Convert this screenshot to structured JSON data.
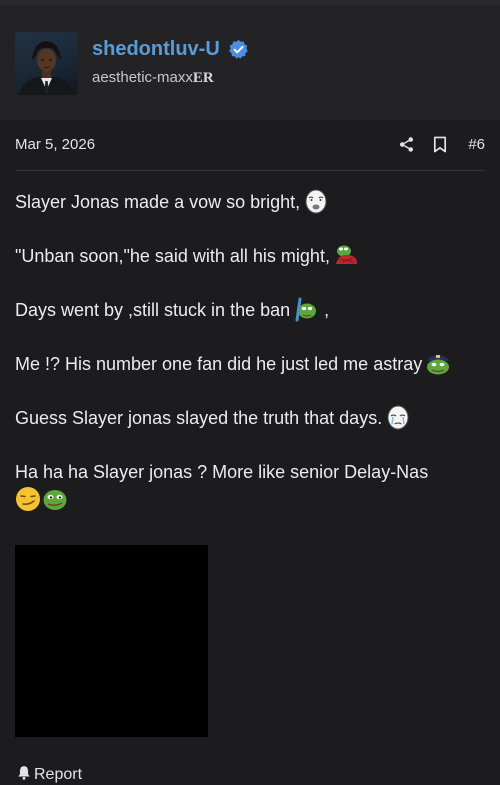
{
  "author": {
    "username": "shedontluv-U",
    "title_main": "aesthetic-maxx",
    "title_emphasis": "ER",
    "verified": true,
    "avatar": "user-avatar-photo"
  },
  "post": {
    "date": "Mar 5, 2026",
    "number": "#6",
    "actions": [
      "share-icon",
      "bookmark-icon"
    ],
    "lines": [
      {
        "text": "Slayer Jonas made a vow so bright,",
        "emojis": [
          "wojak-face-icon"
        ]
      },
      {
        "text": "\"Unban soon,\"he said with all his might,",
        "emojis": [
          "pepe-red-icon"
        ]
      },
      {
        "text": "Days went by ,still stuck in the ban",
        "emojis": [
          "pepe-pointing-icon"
        ],
        "suffix": " ,"
      },
      {
        "text": "Me !? His number one fan did he just led me astray",
        "emojis": [
          "pepe-police-icon"
        ]
      },
      {
        "text": "Guess Slayer jonas slayed the truth that days.",
        "emojis": [
          "wojak-crying-icon"
        ]
      },
      {
        "text": "Ha ha ha Slayer jonas ? More like senior Delay-Nas",
        "emojis": [
          "smirk-face-icon",
          "pepe-smug-icon"
        ]
      }
    ]
  },
  "footer": {
    "report_label": "Report",
    "report_icon": "bell-icon"
  },
  "colors": {
    "background": "#1c1c1e",
    "author_block": "#232326",
    "username": "#5b9bd8",
    "verified_badge": "#4a90e2"
  }
}
